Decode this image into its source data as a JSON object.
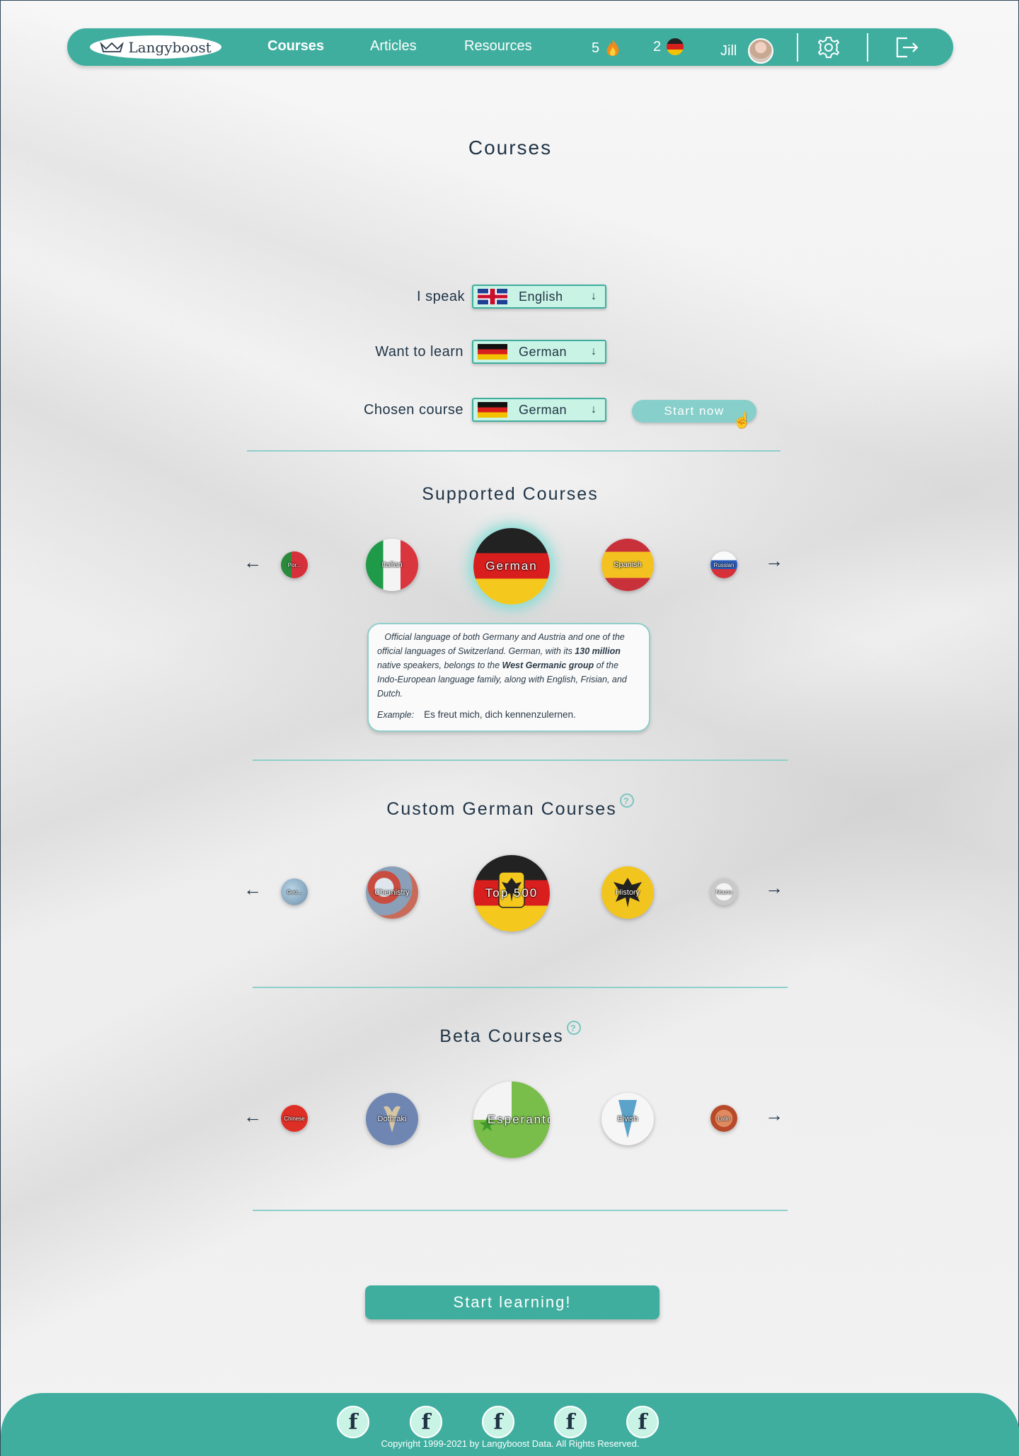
{
  "nav": {
    "logo_text": "Langyboost",
    "logo_icon": "crown-icon",
    "links": [
      {
        "label": "Courses",
        "active": true
      },
      {
        "label": "Articles",
        "active": false
      },
      {
        "label": "Resources",
        "active": false
      }
    ],
    "streak_count": "5",
    "streak_icon": "fire-icon",
    "languages_count": "2",
    "languages_icon": "german-flag-icon",
    "user_name": "Jill",
    "settings_icon": "gear-icon",
    "logout_icon": "logout-icon"
  },
  "page_title": "Courses",
  "form": {
    "speak_label": "I speak",
    "speak_value": "English",
    "learn_label": "Want to learn",
    "learn_value": "German",
    "course_label": "Chosen course",
    "course_value": "German",
    "start_now": "Start now"
  },
  "supported": {
    "title": "Supported Courses",
    "courses": [
      "Por...",
      "Italian",
      "German",
      "Spanish",
      "Russian"
    ],
    "description": {
      "p1": "Official language of both Germany and Austria and one of the official languages of Switzerland. German, with its ",
      "b1": "130 million",
      "p2": " native speakers, belongs to the ",
      "b2": "West Germanic group",
      "p3": " of the Indo-European language family, along with English, Frisian, and Dutch.",
      "example_label": "Example:",
      "example_text": "Es freut mich, dich kennenzulernen."
    }
  },
  "custom": {
    "title": "Custom German Courses",
    "courses": [
      "Geo...",
      "Chemistry",
      "Top 500",
      "History",
      "Nouns"
    ]
  },
  "beta": {
    "title": "Beta Courses",
    "courses": [
      "Chinese",
      "Dothraki",
      "Esperanto",
      "Elvish",
      "Latin"
    ]
  },
  "start_learning": "Start learning!",
  "footer": {
    "social_icons": [
      "facebook-icon",
      "facebook-icon",
      "facebook-icon",
      "facebook-icon",
      "facebook-icon"
    ],
    "copyright": "Copyright 1999-2021 by Langyboost Data. All Rights Reserved."
  },
  "colors": {
    "accent": "#3fae9f",
    "select_bg": "#c9f3e4",
    "divider": "#8fcfca"
  }
}
